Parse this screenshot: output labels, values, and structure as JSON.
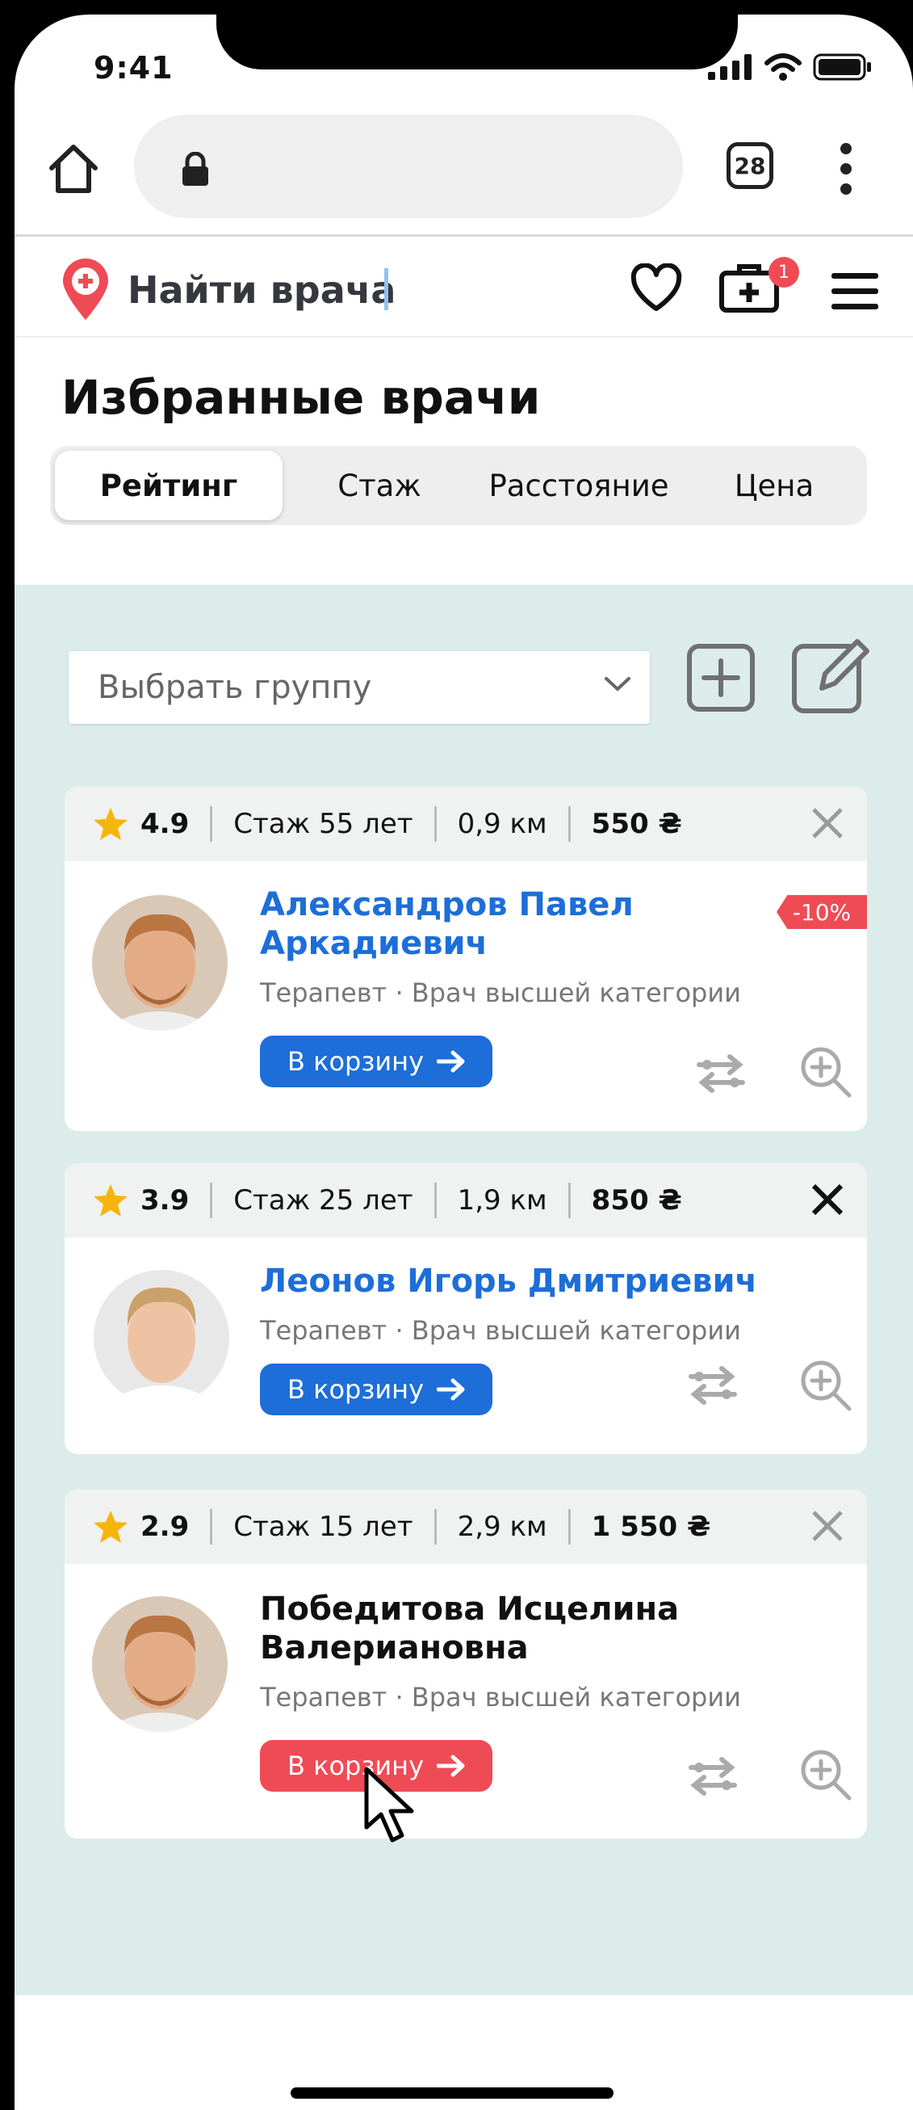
{
  "status_bar": {
    "time": "9:41"
  },
  "browser": {
    "tab_count": "28"
  },
  "site": {
    "title": "Найти врача",
    "cart_badge": "1"
  },
  "page": {
    "title": "Избранные врачи"
  },
  "sort_tabs": [
    {
      "label": "Рейтинг",
      "active": true
    },
    {
      "label": "Стаж",
      "active": false
    },
    {
      "label": "Расстояние",
      "active": false
    },
    {
      "label": "Цена",
      "active": false
    }
  ],
  "group_select": {
    "value": "Выбрать группу"
  },
  "doctors": [
    {
      "rating": "4.9",
      "experience": "Стаж 55 лет",
      "distance": "0,9 км",
      "price": "550 ₴",
      "name_line1": "Александров Павел",
      "name_line2": "Аркадиевич",
      "specialty": "Терапевт · Врач высшей категории",
      "cart_label": "В корзину",
      "discount": "-10%"
    },
    {
      "rating": "3.9",
      "experience": "Стаж 25 лет",
      "distance": "1,9 км",
      "price": "850 ₴",
      "name_line1": "Леонов Игорь Дмитриевич",
      "name_line2": "",
      "specialty": "Терапевт · Врач высшей категории",
      "cart_label": "В корзину"
    },
    {
      "rating": "2.9",
      "experience": "Стаж 15 лет",
      "distance": "2,9 км",
      "price": "1 550 ₴",
      "name_line1": "Победитова Исцелина",
      "name_line2": "Валериановна",
      "specialty": "Терапевт · Врач высшей категории",
      "cart_label": "В корзину"
    }
  ],
  "colors": {
    "accent_blue": "#1d6ed8",
    "accent_red": "#ef4b55",
    "content_bg": "#dcecea"
  }
}
